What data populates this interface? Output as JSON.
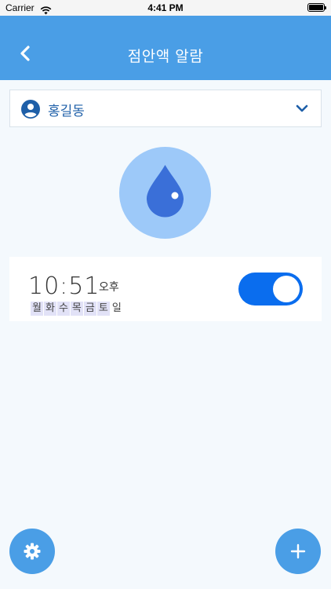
{
  "status_bar": {
    "carrier": "Carrier",
    "time": "4:41 PM"
  },
  "navbar": {
    "title": "점안액 알람",
    "back_icon": "chevron-left-icon"
  },
  "user_select": {
    "name": "홍길동",
    "icon": "user-circle-icon",
    "dropdown_icon": "chevron-down-icon"
  },
  "drop": {
    "icon": "water-drop-icon"
  },
  "alarm": {
    "time": "10:51",
    "ampm": "오후",
    "enabled": true,
    "days": [
      {
        "label": "월",
        "on": true
      },
      {
        "label": "화",
        "on": true
      },
      {
        "label": "수",
        "on": true
      },
      {
        "label": "목",
        "on": true
      },
      {
        "label": "금",
        "on": true
      },
      {
        "label": "토",
        "on": true
      },
      {
        "label": "일",
        "on": false
      }
    ]
  },
  "fabs": {
    "settings_icon": "gear-icon",
    "add_icon": "plus-icon"
  },
  "colors": {
    "primary": "#4a9ee6",
    "toggle_on": "#0a6dee",
    "drop": "#3a6fd8",
    "drop_bg": "#9dc9f9"
  }
}
